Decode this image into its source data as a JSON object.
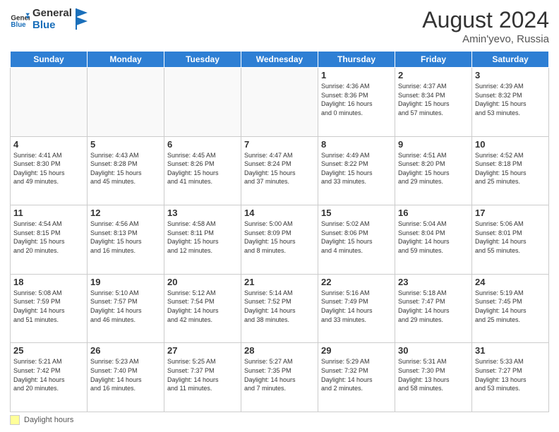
{
  "header": {
    "logo_line1": "General",
    "logo_line2": "Blue",
    "month_year": "August 2024",
    "location": "Amin'yevo, Russia"
  },
  "days_of_week": [
    "Sunday",
    "Monday",
    "Tuesday",
    "Wednesday",
    "Thursday",
    "Friday",
    "Saturday"
  ],
  "footer_label": "Daylight hours",
  "weeks": [
    [
      {
        "day": "",
        "info": ""
      },
      {
        "day": "",
        "info": ""
      },
      {
        "day": "",
        "info": ""
      },
      {
        "day": "",
        "info": ""
      },
      {
        "day": "1",
        "info": "Sunrise: 4:36 AM\nSunset: 8:36 PM\nDaylight: 16 hours\nand 0 minutes."
      },
      {
        "day": "2",
        "info": "Sunrise: 4:37 AM\nSunset: 8:34 PM\nDaylight: 15 hours\nand 57 minutes."
      },
      {
        "day": "3",
        "info": "Sunrise: 4:39 AM\nSunset: 8:32 PM\nDaylight: 15 hours\nand 53 minutes."
      }
    ],
    [
      {
        "day": "4",
        "info": "Sunrise: 4:41 AM\nSunset: 8:30 PM\nDaylight: 15 hours\nand 49 minutes."
      },
      {
        "day": "5",
        "info": "Sunrise: 4:43 AM\nSunset: 8:28 PM\nDaylight: 15 hours\nand 45 minutes."
      },
      {
        "day": "6",
        "info": "Sunrise: 4:45 AM\nSunset: 8:26 PM\nDaylight: 15 hours\nand 41 minutes."
      },
      {
        "day": "7",
        "info": "Sunrise: 4:47 AM\nSunset: 8:24 PM\nDaylight: 15 hours\nand 37 minutes."
      },
      {
        "day": "8",
        "info": "Sunrise: 4:49 AM\nSunset: 8:22 PM\nDaylight: 15 hours\nand 33 minutes."
      },
      {
        "day": "9",
        "info": "Sunrise: 4:51 AM\nSunset: 8:20 PM\nDaylight: 15 hours\nand 29 minutes."
      },
      {
        "day": "10",
        "info": "Sunrise: 4:52 AM\nSunset: 8:18 PM\nDaylight: 15 hours\nand 25 minutes."
      }
    ],
    [
      {
        "day": "11",
        "info": "Sunrise: 4:54 AM\nSunset: 8:15 PM\nDaylight: 15 hours\nand 20 minutes."
      },
      {
        "day": "12",
        "info": "Sunrise: 4:56 AM\nSunset: 8:13 PM\nDaylight: 15 hours\nand 16 minutes."
      },
      {
        "day": "13",
        "info": "Sunrise: 4:58 AM\nSunset: 8:11 PM\nDaylight: 15 hours\nand 12 minutes."
      },
      {
        "day": "14",
        "info": "Sunrise: 5:00 AM\nSunset: 8:09 PM\nDaylight: 15 hours\nand 8 minutes."
      },
      {
        "day": "15",
        "info": "Sunrise: 5:02 AM\nSunset: 8:06 PM\nDaylight: 15 hours\nand 4 minutes."
      },
      {
        "day": "16",
        "info": "Sunrise: 5:04 AM\nSunset: 8:04 PM\nDaylight: 14 hours\nand 59 minutes."
      },
      {
        "day": "17",
        "info": "Sunrise: 5:06 AM\nSunset: 8:01 PM\nDaylight: 14 hours\nand 55 minutes."
      }
    ],
    [
      {
        "day": "18",
        "info": "Sunrise: 5:08 AM\nSunset: 7:59 PM\nDaylight: 14 hours\nand 51 minutes."
      },
      {
        "day": "19",
        "info": "Sunrise: 5:10 AM\nSunset: 7:57 PM\nDaylight: 14 hours\nand 46 minutes."
      },
      {
        "day": "20",
        "info": "Sunrise: 5:12 AM\nSunset: 7:54 PM\nDaylight: 14 hours\nand 42 minutes."
      },
      {
        "day": "21",
        "info": "Sunrise: 5:14 AM\nSunset: 7:52 PM\nDaylight: 14 hours\nand 38 minutes."
      },
      {
        "day": "22",
        "info": "Sunrise: 5:16 AM\nSunset: 7:49 PM\nDaylight: 14 hours\nand 33 minutes."
      },
      {
        "day": "23",
        "info": "Sunrise: 5:18 AM\nSunset: 7:47 PM\nDaylight: 14 hours\nand 29 minutes."
      },
      {
        "day": "24",
        "info": "Sunrise: 5:19 AM\nSunset: 7:45 PM\nDaylight: 14 hours\nand 25 minutes."
      }
    ],
    [
      {
        "day": "25",
        "info": "Sunrise: 5:21 AM\nSunset: 7:42 PM\nDaylight: 14 hours\nand 20 minutes."
      },
      {
        "day": "26",
        "info": "Sunrise: 5:23 AM\nSunset: 7:40 PM\nDaylight: 14 hours\nand 16 minutes."
      },
      {
        "day": "27",
        "info": "Sunrise: 5:25 AM\nSunset: 7:37 PM\nDaylight: 14 hours\nand 11 minutes."
      },
      {
        "day": "28",
        "info": "Sunrise: 5:27 AM\nSunset: 7:35 PM\nDaylight: 14 hours\nand 7 minutes."
      },
      {
        "day": "29",
        "info": "Sunrise: 5:29 AM\nSunset: 7:32 PM\nDaylight: 14 hours\nand 2 minutes."
      },
      {
        "day": "30",
        "info": "Sunrise: 5:31 AM\nSunset: 7:30 PM\nDaylight: 13 hours\nand 58 minutes."
      },
      {
        "day": "31",
        "info": "Sunrise: 5:33 AM\nSunset: 7:27 PM\nDaylight: 13 hours\nand 53 minutes."
      }
    ]
  ]
}
